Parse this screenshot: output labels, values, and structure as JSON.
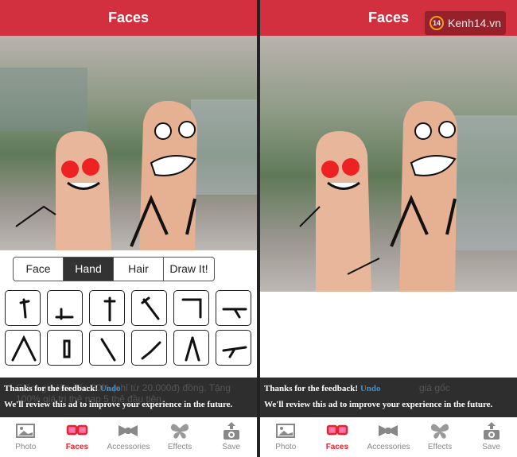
{
  "header": {
    "title": "Faces"
  },
  "watermark": "Kenh14.vn",
  "watermark_badge": "14",
  "segments": [
    {
      "label": "Face"
    },
    {
      "label": "Hand",
      "selected": true
    },
    {
      "label": "Hair"
    },
    {
      "label": "Draw It!"
    }
  ],
  "ad": {
    "feedback": "Thanks for the feedback!",
    "undo": "Undo",
    "message": "We'll review this ad to improve your experience in the future.",
    "background_text": "Giảm giá lên đến 60% (chỉ từ 20.000đ) đồng. Tặng 100% giá trị thẻ nạp 5 thẻ đầu tiên.",
    "background_text_right": "giá gốc"
  },
  "tabs": [
    {
      "label": "Photo",
      "icon": "photo-icon"
    },
    {
      "label": "Faces",
      "icon": "glasses-icon",
      "active": true
    },
    {
      "label": "Accessories",
      "icon": "bowtie-icon"
    },
    {
      "label": "Effects",
      "icon": "butterfly-icon"
    },
    {
      "label": "Save",
      "icon": "save-upload-icon"
    }
  ],
  "colors": {
    "header": "#d3303f",
    "active_tab": "#e8222b",
    "undo": "#3b8fd0"
  }
}
